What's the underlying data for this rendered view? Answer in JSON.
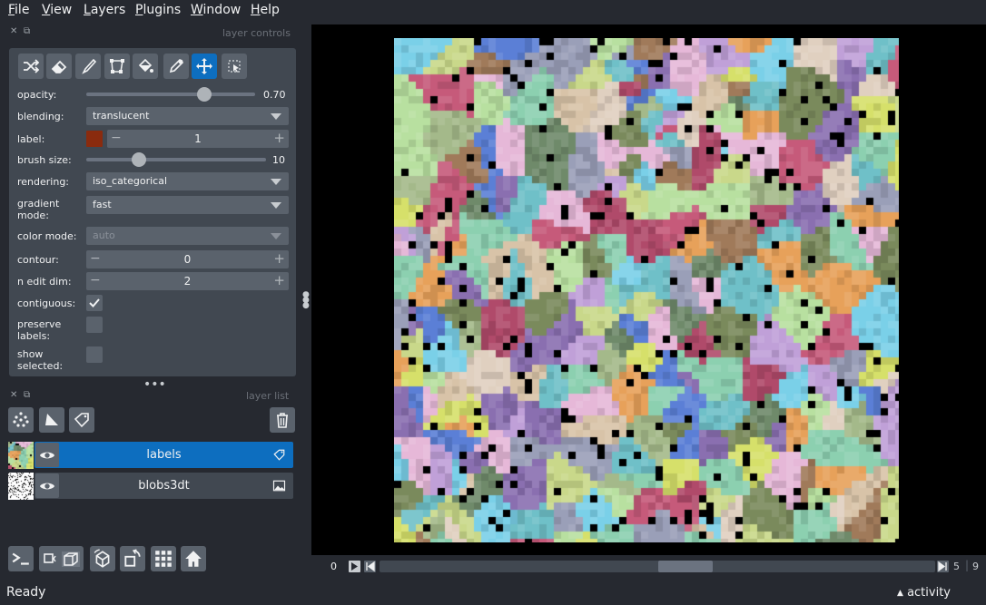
{
  "menu": [
    {
      "label": "File",
      "mnemonic": "F",
      "rest": "ile"
    },
    {
      "label": "View",
      "mnemonic": "V",
      "rest": "iew"
    },
    {
      "label": "Layers",
      "mnemonic": "L",
      "rest": "ayers"
    },
    {
      "label": "Plugins",
      "mnemonic": "P",
      "rest": "lugins"
    },
    {
      "label": "Window",
      "mnemonic": "W",
      "rest": "indow"
    },
    {
      "label": "Help",
      "mnemonic": "H",
      "rest": "elp"
    }
  ],
  "layer_controls": {
    "title": "layer controls",
    "tools": [
      "shuffle-colors-icon",
      "eraser-icon",
      "paintbrush-icon",
      "polygon-icon",
      "fill-bucket-icon",
      "color-picker-icon",
      "pan-zoom-icon",
      "transform-icon"
    ],
    "opacity": {
      "label": "opacity:",
      "value": 0.7,
      "display": "0.70"
    },
    "blending": {
      "label": "blending:",
      "value": "translucent"
    },
    "label": {
      "label": "label:",
      "value": "1",
      "swatch": "#8a2b0e"
    },
    "brush_size": {
      "label": "brush size:",
      "value": 10,
      "display": "10",
      "max": 40
    },
    "rendering": {
      "label": "rendering:",
      "value": "iso_categorical"
    },
    "gradient_mode": {
      "label1": "gradient",
      "label2": "mode:",
      "value": "fast"
    },
    "color_mode": {
      "label": "color mode:",
      "value": "auto"
    },
    "contour": {
      "label": "contour:",
      "value": "0"
    },
    "n_edit_dim": {
      "label": "n edit dim:",
      "value": "2"
    },
    "contiguous": {
      "label": "contiguous:",
      "checked": true
    },
    "preserve_labels": {
      "label1": "preserve",
      "label2": "labels:",
      "checked": false
    },
    "show_selected": {
      "label1": "show",
      "label2": "selected:",
      "checked": false
    }
  },
  "layer_list": {
    "title": "layer list",
    "layers": [
      {
        "name": "labels",
        "selected": true,
        "visible": true,
        "type_icon": "label-tag-icon"
      },
      {
        "name": "blobs3dt",
        "selected": false,
        "visible": true,
        "type_icon": "image-icon"
      }
    ]
  },
  "dims": {
    "current": "0",
    "max_a": "5",
    "max_b": "9"
  },
  "status": {
    "text": "Ready",
    "activity": "activity"
  },
  "colors": {
    "accent": "#0d6ebf",
    "background": "#262930",
    "panel": "#414851",
    "button": "#5a626c"
  }
}
